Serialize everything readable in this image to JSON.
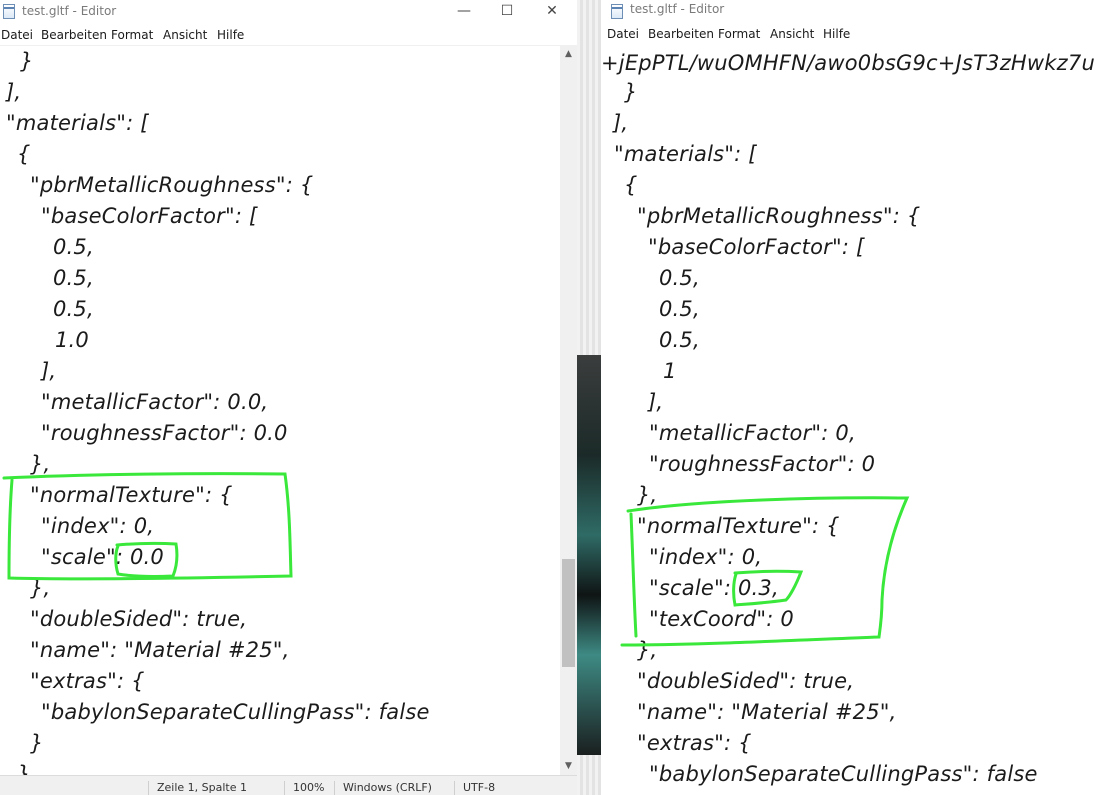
{
  "left_window": {
    "title": "test.gltf - Editor",
    "controls": {
      "minimize": "—",
      "maximize": "☐",
      "close": "✕"
    },
    "menu": [
      "Datei",
      "Bearbeiten",
      "Format",
      "Ansicht",
      "Hilfe"
    ],
    "lines": [
      "}",
      "],",
      "\"materials\": [",
      "{",
      "\"pbrMetallicRoughness\": {",
      "\"baseColorFactor\": [",
      "0.5,",
      "0.5,",
      "0.5,",
      "1.0",
      "],",
      "\"metallicFactor\": 0.0,",
      "\"roughnessFactor\": 0.0",
      "},",
      "\"normalTexture\": {",
      "\"index\": 0,",
      "\"scale\": 0.0",
      "},",
      "\"doubleSided\": true,",
      "\"name\": \"Material #25\",",
      "\"extras\": {",
      "\"babylonSeparateCullingPass\": false",
      "}",
      "}"
    ],
    "status": [
      "Zeile 1, Spalte 1",
      "100%",
      "Windows (CRLF)",
      "UTF-8"
    ]
  },
  "right_window": {
    "title": "test.gltf - Editor",
    "menu": [
      "Datei",
      "Bearbeiten",
      "Format",
      "Ansicht",
      "Hilfe"
    ],
    "lines": [
      "+jEpPTL/wuOMHFN/awo0bsG9c+JsT3zHwkz7u",
      "}",
      "],",
      "\"materials\": [",
      "{",
      "\"pbrMetallicRoughness\": {",
      "\"baseColorFactor\": [",
      "0.5,",
      "0.5,",
      "0.5,",
      "1",
      "],",
      "\"metallicFactor\": 0,",
      "\"roughnessFactor\": 0",
      "},",
      "\"normalTexture\": {",
      "\"index\": 0,",
      "\"scale\": 0.3,",
      "\"texCoord\": 0",
      "},",
      "\"doubleSided\": true,",
      "\"name\": \"Material #25\",",
      "\"extras\": {",
      "\"babylonSeparateCullingPass\": false"
    ]
  },
  "annotation_color": "#39e83a"
}
